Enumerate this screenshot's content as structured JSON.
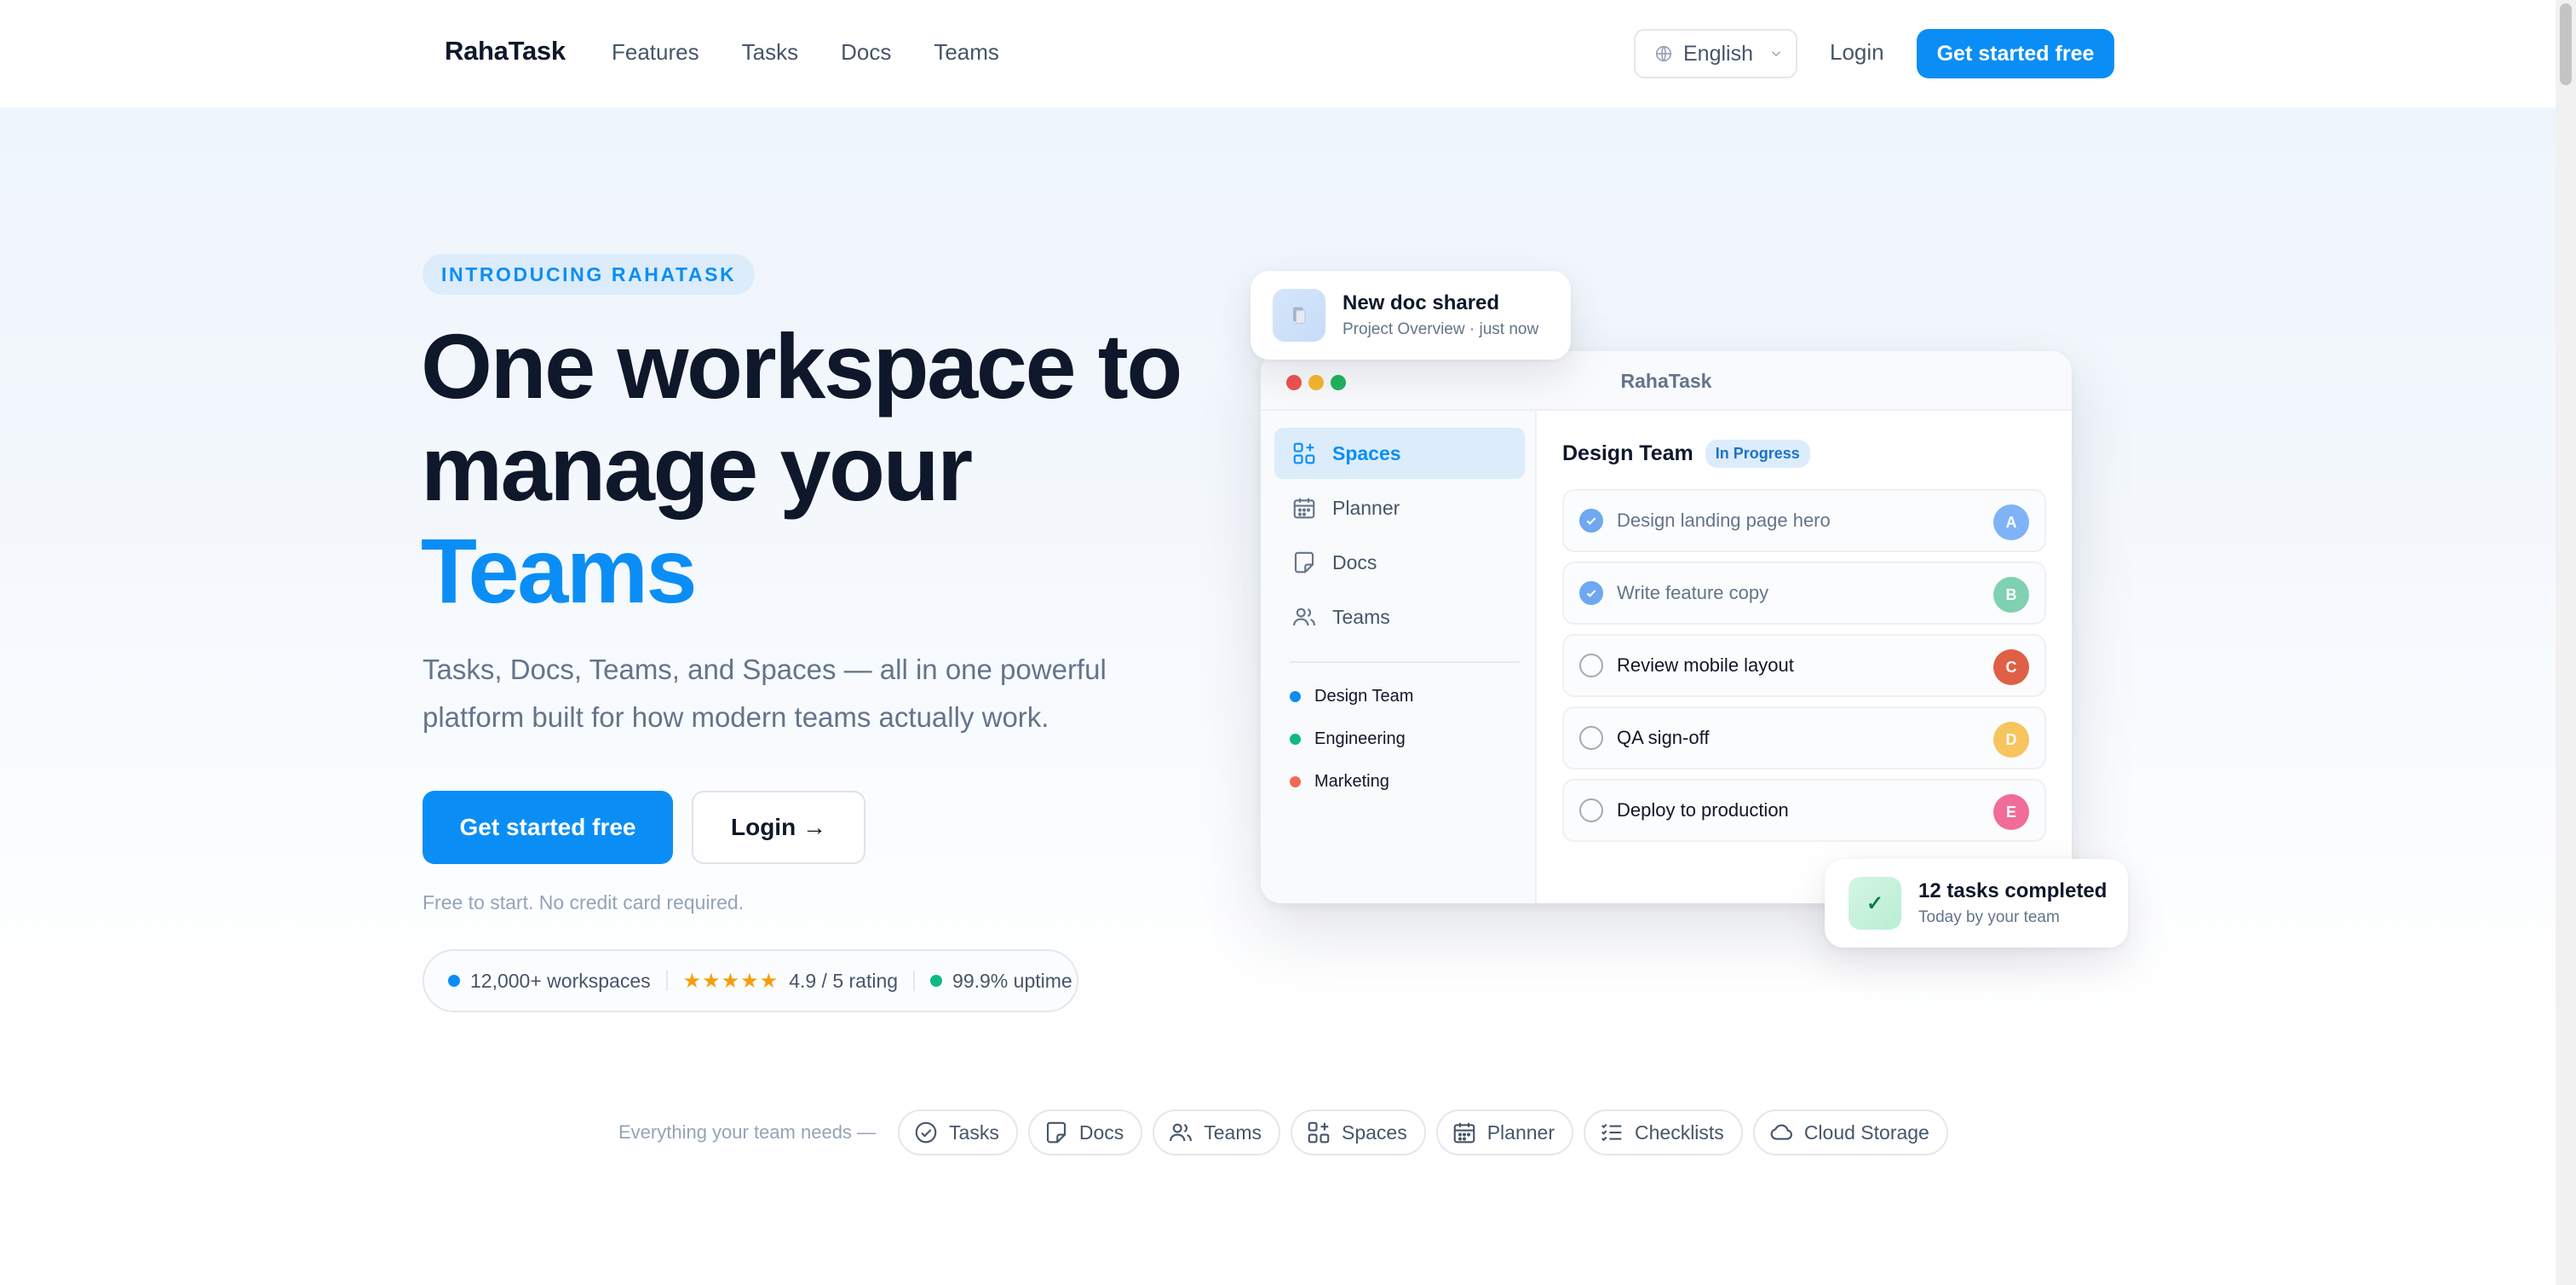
{
  "nav": {
    "brand": "RahaTask",
    "links": [
      "Features",
      "Tasks",
      "Docs",
      "Teams"
    ],
    "language": "English",
    "login": "Login",
    "cta": "Get started free"
  },
  "hero": {
    "eyebrow": "INTRODUCING RAHATASK",
    "headline_line1": "One workspace to",
    "headline_line2": "manage your",
    "headline_accent": "Teams",
    "subtitle": "Tasks, Docs, Teams, and Spaces — all in one powerful platform built for how modern teams actually work.",
    "primary_button": "Get started free",
    "secondary_button": "Login →",
    "fine_print": "Free to start. No credit card required.",
    "stats": {
      "workspaces": "12,000+ workspaces",
      "stars": "★★★★★",
      "rating": "4.9 / 5 rating",
      "uptime": "99.9% uptime"
    }
  },
  "app": {
    "title": "RahaTask",
    "sidebar": [
      "Spaces",
      "Planner",
      "Docs",
      "Teams"
    ],
    "spaces": [
      {
        "name": "Design Team",
        "color": "#0a8ef5"
      },
      {
        "name": "Engineering",
        "color": "#10b981"
      },
      {
        "name": "Marketing",
        "color": "#ef6a50"
      }
    ],
    "team_title": "Design Team",
    "status_badge": "In Progress",
    "tasks": [
      {
        "label": "Design landing page hero",
        "done": true,
        "avatar": "A",
        "color": "#7fb3f5"
      },
      {
        "label": "Write feature copy",
        "done": true,
        "avatar": "B",
        "color": "#7fd1b1"
      },
      {
        "label": "Review mobile layout",
        "done": false,
        "avatar": "C",
        "color": "#df6046"
      },
      {
        "label": "QA sign-off",
        "done": false,
        "avatar": "D",
        "color": "#f7c45e"
      },
      {
        "label": "Deploy to production",
        "done": false,
        "avatar": "E",
        "color": "#f16d98"
      }
    ]
  },
  "notifications": {
    "doc_title": "New doc shared",
    "doc_sub": "Project Overview · just now",
    "done_title": "12 tasks completed",
    "done_sub": "Today by your team",
    "done_icon": "✓"
  },
  "strip": {
    "label": "Everything your team needs —",
    "chips": [
      "Tasks",
      "Docs",
      "Teams",
      "Spaces",
      "Planner",
      "Checklists",
      "Cloud Storage"
    ]
  },
  "colors": {
    "brand": "#0a8ef5",
    "heading": "#0f172a",
    "muted": "#64748b"
  }
}
